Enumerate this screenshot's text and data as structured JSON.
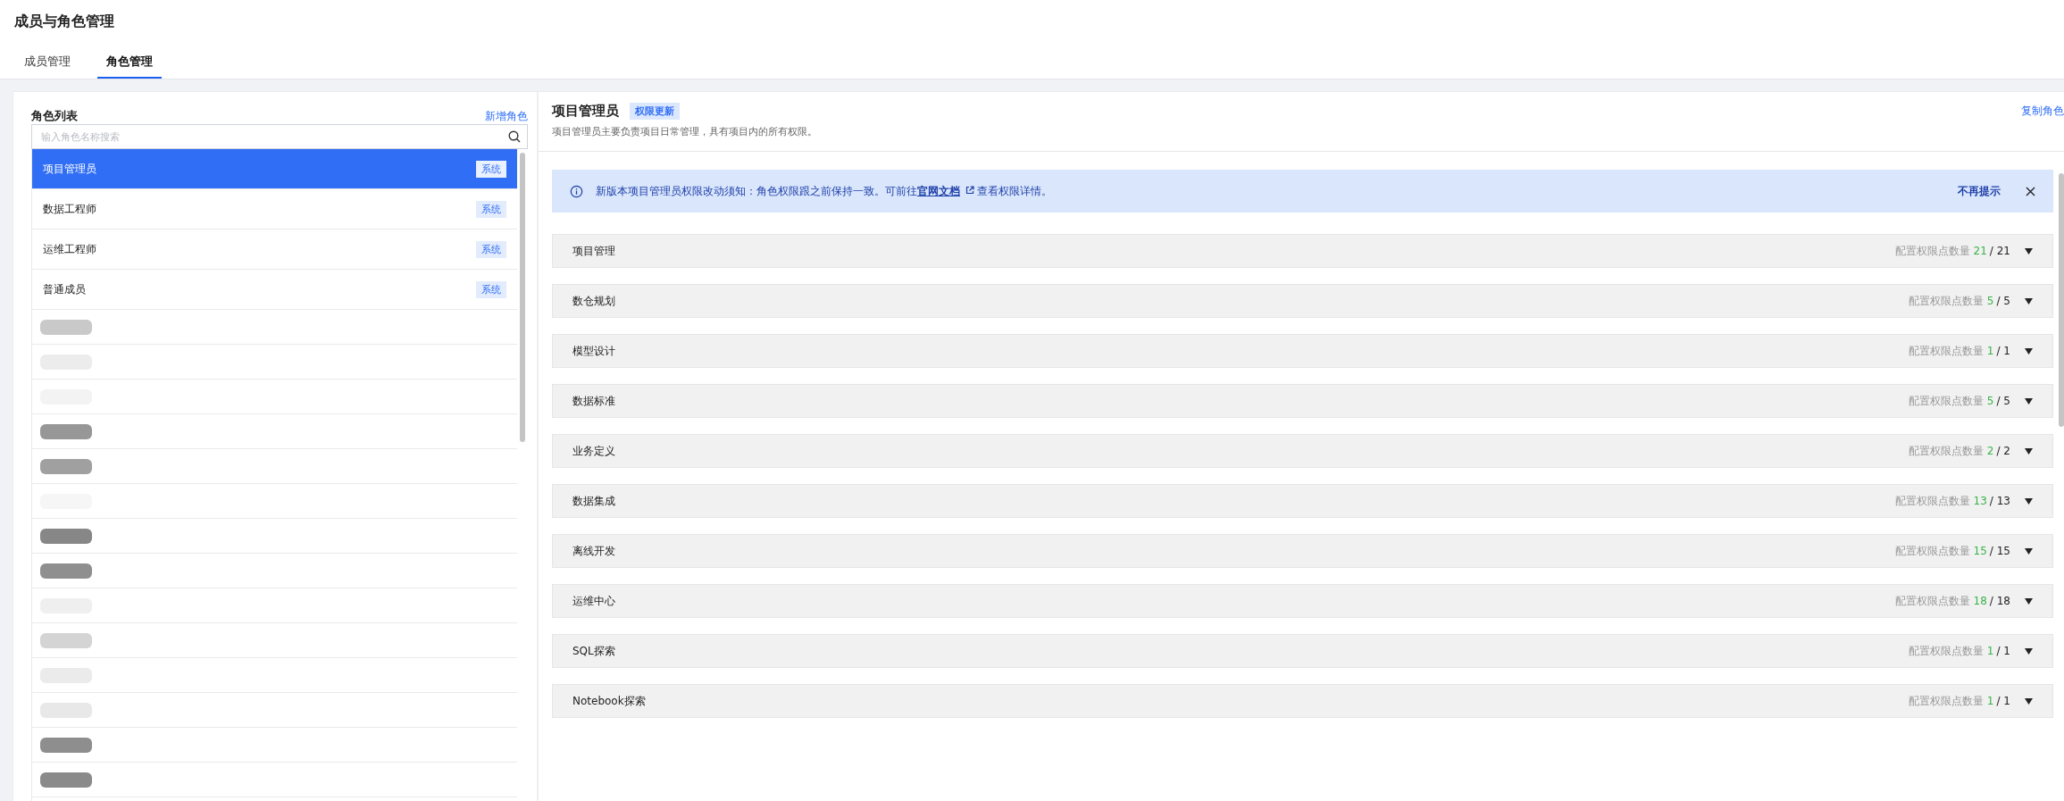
{
  "page_title": "成员与角色管理",
  "tabs": [
    {
      "label": "成员管理",
      "selected": false
    },
    {
      "label": "角色管理",
      "selected": true
    }
  ],
  "role_list": {
    "title": "角色列表",
    "add_link": "新增角色",
    "search": {
      "placeholder": "输入角色名称搜索"
    },
    "roles": [
      {
        "kind": "role",
        "name": "项目管理员",
        "tag": "系统",
        "selected": true
      },
      {
        "kind": "role",
        "name": "数据工程师",
        "tag": "系统",
        "selected": false
      },
      {
        "kind": "role",
        "name": "运维工程师",
        "tag": "系统",
        "selected": false
      },
      {
        "kind": "role",
        "name": "普通成员",
        "tag": "系统",
        "selected": false
      },
      {
        "kind": "redacted",
        "selected": false,
        "color": "#c9c9c9"
      },
      {
        "kind": "redacted",
        "selected": false,
        "color": "#ececec"
      },
      {
        "kind": "redacted",
        "selected": false,
        "color": "#f3f3f3"
      },
      {
        "kind": "redacted",
        "selected": false,
        "color": "#979797"
      },
      {
        "kind": "redacted",
        "selected": false,
        "color": "#a0a0a0"
      },
      {
        "kind": "redacted",
        "selected": false,
        "color": "#f6f6f6"
      },
      {
        "kind": "redacted",
        "selected": false,
        "color": "#878787"
      },
      {
        "kind": "redacted",
        "selected": false,
        "color": "#8f8f8f"
      },
      {
        "kind": "redacted",
        "selected": false,
        "color": "#efefef"
      },
      {
        "kind": "redacted",
        "selected": false,
        "color": "#d4d4d4"
      },
      {
        "kind": "redacted",
        "selected": false,
        "color": "#ebebeb"
      },
      {
        "kind": "redacted",
        "selected": false,
        "color": "#e8e8e8"
      },
      {
        "kind": "redacted",
        "selected": false,
        "color": "#8e8e8e"
      },
      {
        "kind": "redacted",
        "selected": false,
        "color": "#8a8a8a"
      }
    ]
  },
  "detail": {
    "title": "项目管理员",
    "badge": "权限更新",
    "copy_link": "复制角色",
    "description": "项目管理员主要负责项目日常管理，具有项目内的所有权限。",
    "notice": {
      "text_before": "新版本项目管理员权限改动须知：角色权限跟之前保持一致。可前往",
      "link": "官网文档",
      "text_after": "查看权限详情。",
      "dismiss": "不再提示"
    },
    "sections": [
      {
        "name": "项目管理",
        "label": "配置权限点数量",
        "granted": "21",
        "total": "/ 21",
        "expanded": false
      },
      {
        "name": "数仓规划",
        "label": "配置权限点数量",
        "granted": "5",
        "total": "/ 5",
        "expanded": false
      },
      {
        "name": "模型设计",
        "label": "配置权限点数量",
        "granted": "1",
        "total": "/ 1",
        "expanded": false
      },
      {
        "name": "数据标准",
        "label": "配置权限点数量",
        "granted": "5",
        "total": "/ 5",
        "expanded": false
      },
      {
        "name": "业务定义",
        "label": "配置权限点数量",
        "granted": "2",
        "total": "/ 2",
        "expanded": false
      },
      {
        "name": "数据集成",
        "label": "配置权限点数量",
        "granted": "13",
        "total": "/ 13",
        "expanded": false
      },
      {
        "name": "离线开发",
        "label": "配置权限点数量",
        "granted": "15",
        "total": "/ 15",
        "expanded": false
      },
      {
        "name": "运维中心",
        "label": "配置权限点数量",
        "granted": "18",
        "total": "/ 18",
        "expanded": false
      },
      {
        "name": "SQL探索",
        "label": "配置权限点数量",
        "granted": "1",
        "total": "/ 1",
        "expanded": false
      },
      {
        "name": "Notebook探索",
        "label": "配置权限点数量",
        "granted": "1",
        "total": "/ 1",
        "expanded": false
      }
    ]
  }
}
